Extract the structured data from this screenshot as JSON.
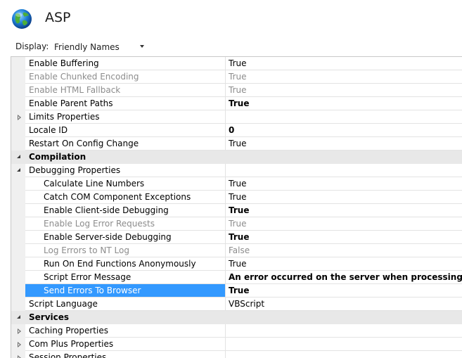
{
  "header": {
    "title": "ASP"
  },
  "display": {
    "label": "Display:",
    "value": "Friendly Names"
  },
  "rows": [
    {
      "kind": "prop",
      "indent": 1,
      "name": "Enable Buffering",
      "value": "True",
      "disabled": false,
      "bold": false
    },
    {
      "kind": "prop",
      "indent": 1,
      "name": "Enable Chunked Encoding",
      "value": "True",
      "disabled": true,
      "bold": false
    },
    {
      "kind": "prop",
      "indent": 1,
      "name": "Enable HTML Fallback",
      "value": "True",
      "disabled": true,
      "bold": false
    },
    {
      "kind": "prop",
      "indent": 1,
      "name": "Enable Parent Paths",
      "value": "True",
      "disabled": false,
      "bold": true
    },
    {
      "kind": "group",
      "indent": 1,
      "name": "Limits Properties",
      "value": "",
      "expanded": false
    },
    {
      "kind": "prop",
      "indent": 1,
      "name": "Locale ID",
      "value": "0",
      "disabled": false,
      "bold": true
    },
    {
      "kind": "prop",
      "indent": 1,
      "name": "Restart On Config Change",
      "value": "True",
      "disabled": false,
      "bold": false
    },
    {
      "kind": "category",
      "name": "Compilation",
      "expanded": true
    },
    {
      "kind": "group",
      "indent": 1,
      "name": "Debugging Properties",
      "value": "",
      "expanded": true
    },
    {
      "kind": "prop",
      "indent": 2,
      "name": "Calculate Line Numbers",
      "value": "True",
      "disabled": false,
      "bold": false
    },
    {
      "kind": "prop",
      "indent": 2,
      "name": "Catch COM Component Exceptions",
      "value": "True",
      "disabled": false,
      "bold": false
    },
    {
      "kind": "prop",
      "indent": 2,
      "name": "Enable Client-side Debugging",
      "value": "True",
      "disabled": false,
      "bold": true
    },
    {
      "kind": "prop",
      "indent": 2,
      "name": "Enable Log Error Requests",
      "value": "True",
      "disabled": true,
      "bold": false
    },
    {
      "kind": "prop",
      "indent": 2,
      "name": "Enable Server-side Debugging",
      "value": "True",
      "disabled": false,
      "bold": true
    },
    {
      "kind": "prop",
      "indent": 2,
      "name": "Log Errors to NT Log",
      "value": "False",
      "disabled": true,
      "bold": false
    },
    {
      "kind": "prop",
      "indent": 2,
      "name": "Run On End Functions Anonymously",
      "value": "True",
      "disabled": false,
      "bold": false
    },
    {
      "kind": "prop",
      "indent": 2,
      "name": "Script Error Message",
      "value": "An error occurred on the server when processing the URL. P",
      "disabled": false,
      "bold": true
    },
    {
      "kind": "prop",
      "indent": 2,
      "name": "Send Errors To Browser",
      "value": "True",
      "disabled": false,
      "bold": true,
      "selected": true
    },
    {
      "kind": "prop",
      "indent": 1,
      "name": "Script Language",
      "value": "VBScript",
      "disabled": false,
      "bold": false
    },
    {
      "kind": "category",
      "name": "Services",
      "expanded": true
    },
    {
      "kind": "group",
      "indent": 1,
      "name": "Caching Properties",
      "value": "",
      "expanded": false
    },
    {
      "kind": "group",
      "indent": 1,
      "name": "Com Plus Properties",
      "value": "",
      "expanded": false
    },
    {
      "kind": "group",
      "indent": 1,
      "name": "Session Properties",
      "value": "",
      "expanded": false
    }
  ],
  "icons": {
    "header": "globe-icon",
    "display": "chevron-down-icon",
    "collapsed": "triangle-right-icon",
    "expanded": "triangle-down-icon"
  },
  "colors": {
    "selection": "#3399ff",
    "category_bg": "#e8e8e8",
    "disabled_text": "#8c8c8c"
  }
}
